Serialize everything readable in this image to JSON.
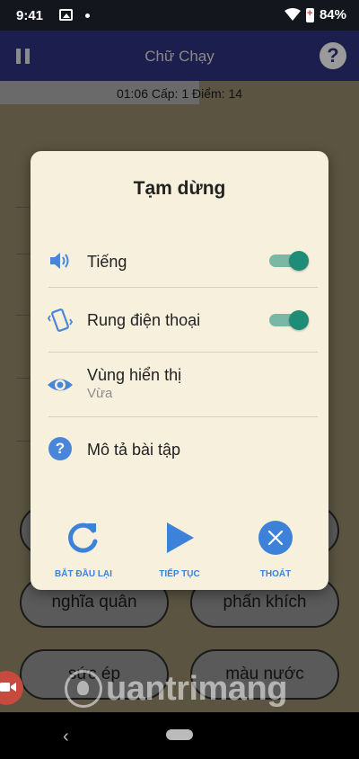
{
  "status_bar": {
    "time": "9:41",
    "battery": "84%"
  },
  "header": {
    "title": "Chữ Chạy"
  },
  "info": {
    "text": "01:06  Cấp: 1  Điểm: 14",
    "time_progress": 0.555
  },
  "game": {
    "pills": [
      {
        "label": ""
      },
      {
        "label": ""
      },
      {
        "label": "nghĩa quân"
      },
      {
        "label": "phấn khích"
      },
      {
        "label": "sức ép"
      },
      {
        "label": "màu nước"
      }
    ]
  },
  "dialog": {
    "title": "Tạm dừng",
    "sound": {
      "label": "Tiếng",
      "enabled": true
    },
    "vibrate": {
      "label": "Rung điện thoại",
      "enabled": true
    },
    "display": {
      "label": "Vùng hiển thị",
      "value": "Vừa"
    },
    "description": {
      "label": "Mô tả bài tập"
    },
    "actions": {
      "restart": "BẮT ĐẦU LẠI",
      "resume": "TIẾP TỤC",
      "exit": "THOÁT"
    }
  },
  "watermark": {
    "text": "uantrimang"
  },
  "colors": {
    "accent_blue": "#3d82d8",
    "toggle_on": "#1e8c77",
    "dialog_bg": "#f6f0dc",
    "header_bg": "#1c1f4e"
  }
}
